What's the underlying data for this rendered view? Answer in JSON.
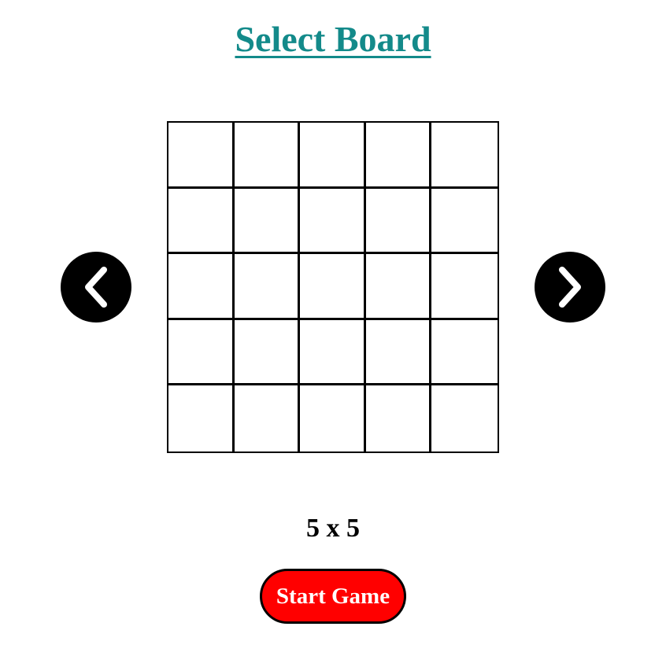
{
  "page": {
    "title": "Select Board"
  },
  "board": {
    "rows": 5,
    "cols": 5,
    "size_label": "5 x 5"
  },
  "navigation": {
    "prev_icon": "chevron-left-icon",
    "next_icon": "chevron-right-icon"
  },
  "actions": {
    "start_label": "Start Game"
  },
  "colors": {
    "title": "#138a8a",
    "start_button": "#ff0000",
    "nav_button": "#000000",
    "grid_line": "#000000"
  }
}
